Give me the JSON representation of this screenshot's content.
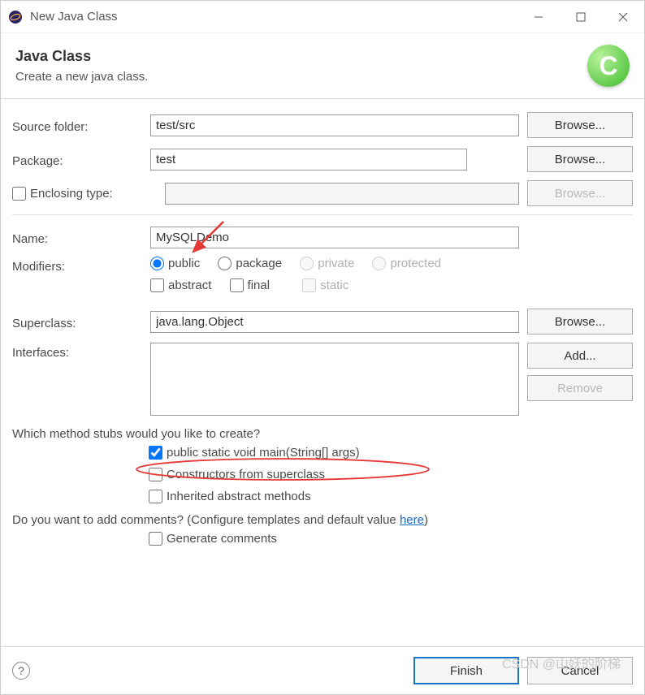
{
  "window": {
    "title": "New Java Class"
  },
  "header": {
    "title": "Java Class",
    "subtitle": "Create a new java class."
  },
  "labels": {
    "sourceFolder": "Source folder:",
    "package": "Package:",
    "enclosingType": "Enclosing type:",
    "name": "Name:",
    "modifiers": "Modifiers:",
    "superclass": "Superclass:",
    "interfaces": "Interfaces:",
    "stubsQuestion": "Which method stubs would you like to create?",
    "commentsQuestion": "Do you want to add comments? (Configure templates and default value ",
    "hereLink": "here",
    "closeParen": ")"
  },
  "values": {
    "sourceFolder": "test/src",
    "package": "test",
    "enclosingType": "",
    "name": "MySQLDemo",
    "superclass": "java.lang.Object",
    "interfaces": ""
  },
  "modifiers": {
    "radios": {
      "public": "public",
      "package": "package",
      "private": "private",
      "protected": "protected"
    },
    "checks": {
      "abstract": "abstract",
      "final": "final",
      "static": "static"
    }
  },
  "stubs": {
    "main": "public static void main(String[] args)",
    "constructors": "Constructors from superclass",
    "inherited": "Inherited abstract methods"
  },
  "comments": {
    "generate": "Generate comments"
  },
  "buttons": {
    "browse": "Browse...",
    "add": "Add...",
    "remove": "Remove",
    "finish": "Finish",
    "cancel": "Cancel"
  },
  "watermark": "CSDN @山妖的阶梯"
}
